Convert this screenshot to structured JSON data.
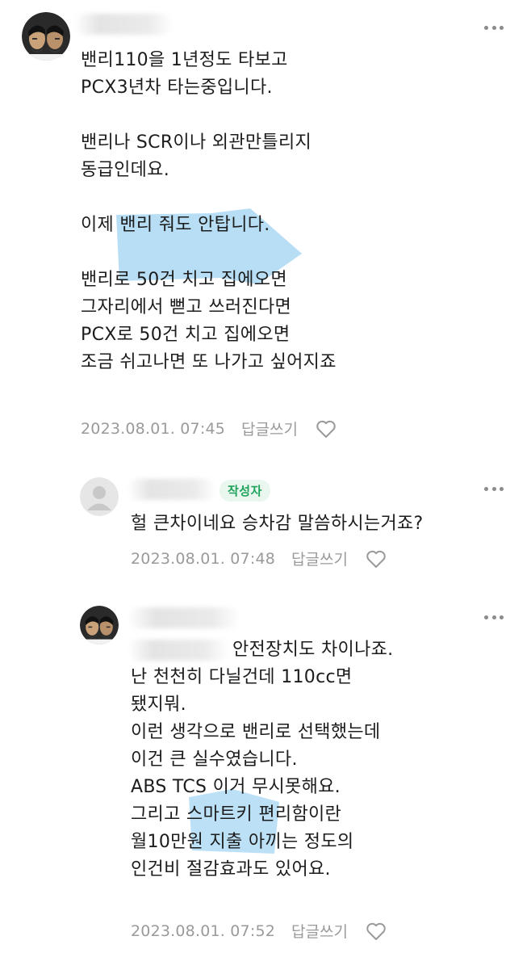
{
  "comments": [
    {
      "text": "밴리110을 1년정도 타보고\nPCX3년차 타는중입니다.\n\n밴리나 SCR이나 외관만틀리지\n동급인데요.\n\n이제 밴리 줘도 안탑니다.\n\n밴리로 50건 치고 집에오면\n그자리에서 뻗고 쓰러진다면\nPCX로 50건 치고 집에오면\n조금 쉬고나면 또 나가고 싶어지죠",
      "date": "2023.08.01. 07:45",
      "reply_label": "답글쓰기",
      "avatar_icon": "cartoon-faces-avatar",
      "more_icon": "more-options-icon",
      "heart_icon": "heart-outline-icon"
    },
    {
      "badge": "작성자",
      "text": "헐 큰차이네요 승차감 말씀하시는거죠?",
      "date": "2023.08.01. 07:48",
      "reply_label": "답글쓰기",
      "avatar_icon": "default-user-avatar",
      "more_icon": "more-options-icon",
      "heart_icon": "heart-outline-icon"
    },
    {
      "text": "안전장치도 차이나죠.\n난 천천히 다닐건데 110cc면\n됐지뭐.\n이런 생각으로 밴리로 선택했는데\n이건 큰 실수였습니다.\nABS TCS 이거 무시못해요.\n그리고 스마트키 편리함이란\n월10만원 지출 아끼는 정도의\n인건비 절감효과도 있어요.",
      "date": "2023.08.01. 07:52",
      "reply_label": "답글쓰기",
      "avatar_icon": "cartoon-faces-avatar",
      "more_icon": "more-options-icon",
      "heart_icon": "heart-outline-icon"
    }
  ],
  "colors": {
    "text": "#1c1c1c",
    "meta": "#9a9a9a",
    "badge_text": "#1fa35a",
    "badge_bg": "#e9f7ee",
    "highlight": "#9fd3f2"
  }
}
